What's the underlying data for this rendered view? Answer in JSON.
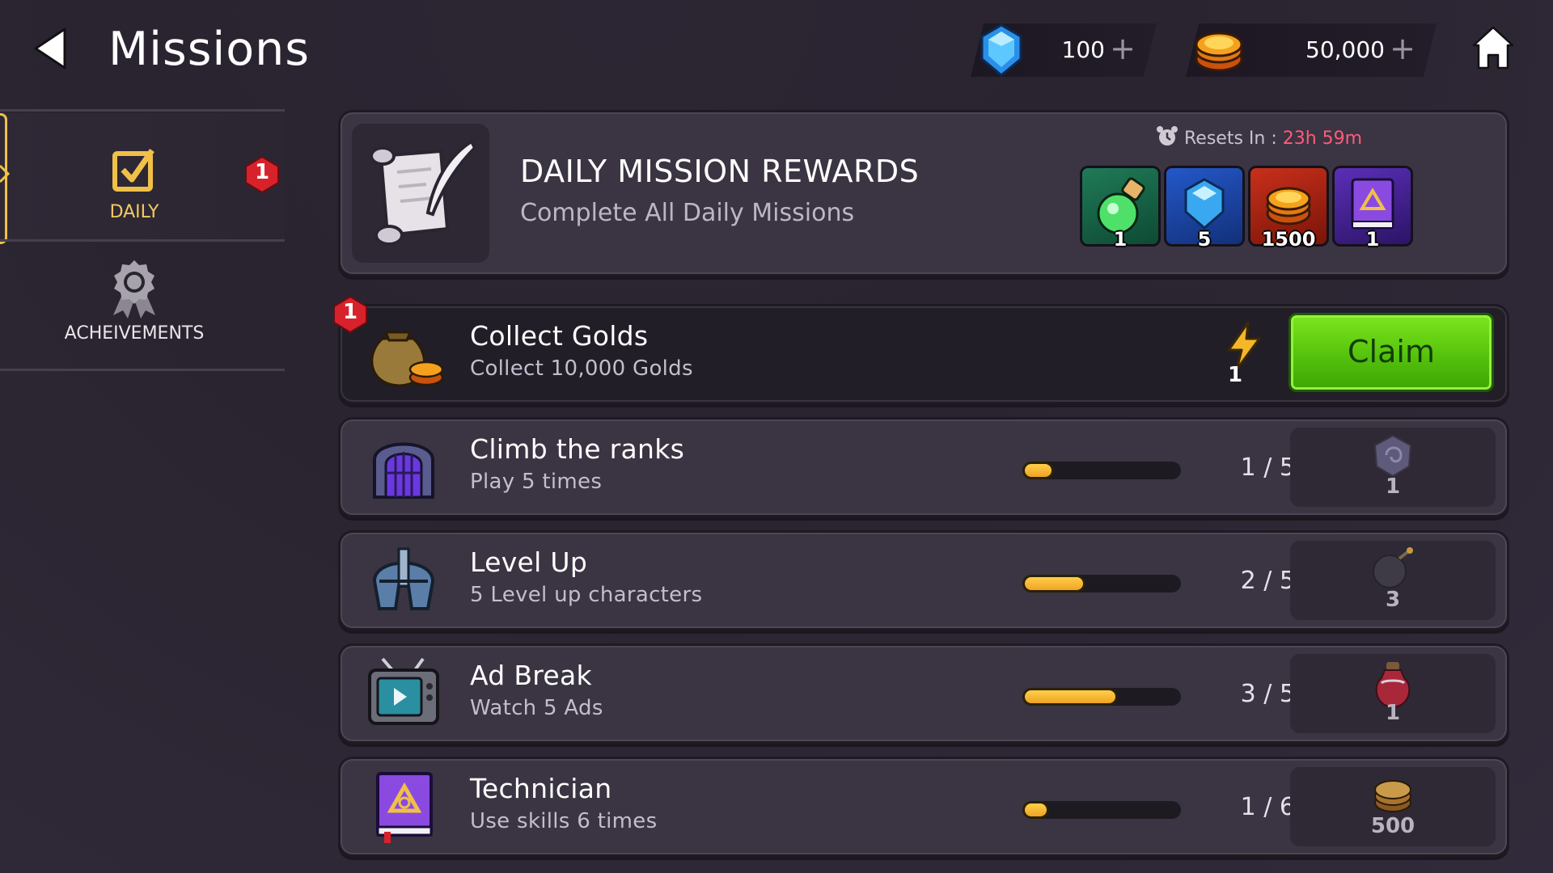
{
  "header": {
    "title": "Missions",
    "gems": "100",
    "gold": "50,000",
    "plus_symbol": "+"
  },
  "sidebar": {
    "tabs": [
      {
        "label": "DAILY",
        "badge": "1",
        "selected": true
      },
      {
        "label": "ACHEIVEMENTS",
        "selected": false
      }
    ]
  },
  "daily_rewards": {
    "title": "DAILY MISSION REWARDS",
    "subtitle": "Complete All Daily Missions",
    "reset_label": "Resets In : ",
    "reset_time": "23h 59m",
    "rewards": [
      {
        "icon": "green-potion-icon",
        "qty": "1"
      },
      {
        "icon": "gem-icon",
        "qty": "5"
      },
      {
        "icon": "gold-coins-icon",
        "qty": "1500"
      },
      {
        "icon": "spell-book-icon",
        "qty": "1"
      }
    ]
  },
  "missions": [
    {
      "title": "Collect Golds",
      "desc": "Collect 10,000 Golds",
      "icon": "gold-bag-icon",
      "badge": "1",
      "claim_label": "Claim",
      "reward_icon": "energy-bolt-icon",
      "reward_qty": "1",
      "completed": true
    },
    {
      "title": "Climb the ranks",
      "desc": "Play 5 times",
      "icon": "arena-gate-icon",
      "progress": "1 / 5",
      "progress_fraction": 0.2,
      "reward_icon": "rune-stone-icon",
      "reward_qty": "1"
    },
    {
      "title": "Level Up",
      "desc": "5 Level up characters",
      "icon": "knight-helmet-icon",
      "progress": "2 / 5",
      "progress_fraction": 0.4,
      "reward_icon": "bomb-icon",
      "reward_qty": "3"
    },
    {
      "title": "Ad Break",
      "desc": "Watch 5 Ads",
      "icon": "tv-icon",
      "progress": "3 / 5",
      "progress_fraction": 0.6,
      "reward_icon": "red-potion-icon",
      "reward_qty": "1"
    },
    {
      "title": "Technician",
      "desc": "Use skills 6 times",
      "icon": "spell-book-icon",
      "progress": "1 / 6",
      "progress_fraction": 0.1667,
      "reward_icon": "gold-coins-icon",
      "reward_qty": "500"
    }
  ],
  "colors": {
    "accent_gold": "#f3ca63",
    "timer_red": "#ff5b7b",
    "claim_green": "#5ac80e",
    "progress_orange": "#f6b52e"
  }
}
